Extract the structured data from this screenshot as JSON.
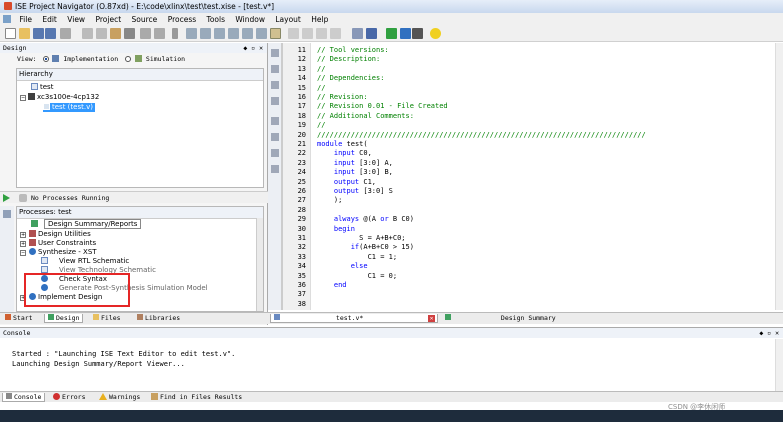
{
  "window": {
    "title": "ISE Project Navigator (O.87xd) - E:\\code\\xlinx\\test\\test.xise - [test.v*]"
  },
  "menu": [
    "File",
    "Edit",
    "View",
    "Project",
    "Source",
    "Process",
    "Tools",
    "Window",
    "Layout",
    "Help"
  ],
  "design_panel": {
    "title": "Design",
    "view_label": "View:",
    "implementation_label": "Implementation",
    "simulation_label": "Simulation",
    "hierarchy_label": "Hierarchy",
    "tree": [
      "test",
      "xc3s100e-4cp132",
      "test (test.v)"
    ]
  },
  "processes": {
    "status": "No Processes Running",
    "title": "Processes: test",
    "items": [
      "Design Summary/Reports",
      "Design Utilities",
      "User Constraints",
      "Synthesize - XST",
      "View RTL Schematic",
      "View Technology Schematic",
      "Check Syntax",
      "Generate Post-Synthesis Simulation Model",
      "Implement Design"
    ]
  },
  "left_tabs": [
    "Start",
    "Design",
    "Files",
    "Libraries"
  ],
  "editor": {
    "lines": [
      {
        "n": "11",
        "text": "// Tool versions:",
        "cls": "comment"
      },
      {
        "n": "12",
        "text": "// Description:",
        "cls": "comment"
      },
      {
        "n": "13",
        "text": "//",
        "cls": "comment"
      },
      {
        "n": "14",
        "text": "// Dependencies:",
        "cls": "comment"
      },
      {
        "n": "15",
        "text": "//",
        "cls": "comment"
      },
      {
        "n": "16",
        "text": "// Revision:",
        "cls": "comment"
      },
      {
        "n": "17",
        "text": "// Revision 0.01 - File Created",
        "cls": "comment"
      },
      {
        "n": "18",
        "text": "// Additional Comments:",
        "cls": "comment"
      },
      {
        "n": "19",
        "text": "//",
        "cls": "comment"
      },
      {
        "n": "20",
        "text": "//////////////////////////////////////////////////////////////////////////////",
        "cls": "comment"
      },
      {
        "n": "21",
        "text": "module test(",
        "cls": "mixed"
      },
      {
        "n": "22",
        "text": "    input C0,",
        "cls": "mixed"
      },
      {
        "n": "23",
        "text": "    input [3:0] A,",
        "cls": "mixed"
      },
      {
        "n": "24",
        "text": "    input [3:0] B,",
        "cls": "mixed"
      },
      {
        "n": "25",
        "text": "    output C1,",
        "cls": "mixed"
      },
      {
        "n": "26",
        "text": "    output [3:0] S",
        "cls": "mixed"
      },
      {
        "n": "27",
        "text": "    );",
        "cls": "plain"
      },
      {
        "n": "28",
        "text": "",
        "cls": "plain"
      },
      {
        "n": "29",
        "text": "    always @(A or B C0)",
        "cls": "mixed"
      },
      {
        "n": "30",
        "text": "    begin",
        "cls": "mixed"
      },
      {
        "n": "31",
        "text": "          S = A+B+C0;",
        "cls": "plain"
      },
      {
        "n": "32",
        "text": "        if(A+B+C0 > 15)",
        "cls": "mixed"
      },
      {
        "n": "33",
        "text": "            C1 = 1;",
        "cls": "plain"
      },
      {
        "n": "34",
        "text": "        else",
        "cls": "mixed"
      },
      {
        "n": "35",
        "text": "            C1 = 0;",
        "cls": "plain"
      },
      {
        "n": "36",
        "text": "    end",
        "cls": "mixed"
      },
      {
        "n": "37",
        "text": "",
        "cls": "plain"
      },
      {
        "n": "38",
        "text": "",
        "cls": "plain"
      }
    ],
    "tabs": [
      "test.v*",
      "Design Summary"
    ]
  },
  "console": {
    "title": "Console",
    "lines": [
      "Started : \"Launching ISE Text Editor to edit test.v\".",
      "Launching Design Summary/Report Viewer..."
    ]
  },
  "bottom_tabs": [
    "Console",
    "Errors",
    "Warnings",
    "Find in Files Results"
  ],
  "watermark": "CSDN @李休闲师",
  "colors": {
    "comment": "#008000",
    "keyword": "#0000ff",
    "highlight": "#e52626"
  }
}
